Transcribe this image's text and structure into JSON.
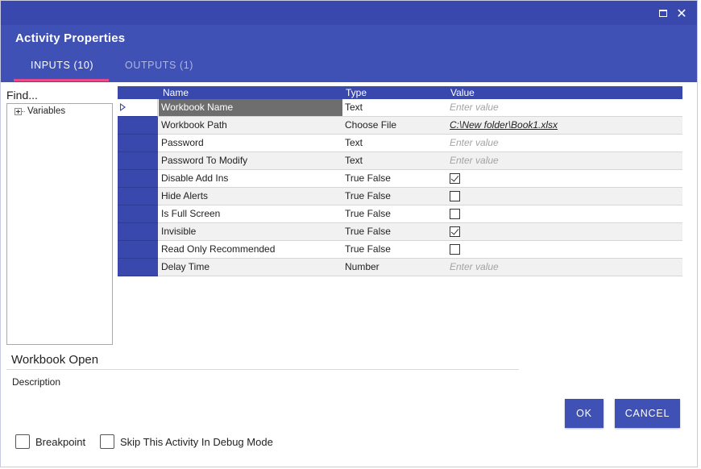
{
  "window": {
    "title": "Activity Properties",
    "maximize_icon": "maximize-icon",
    "close_icon": "close-icon",
    "close_glyph": "✕"
  },
  "tabs": [
    {
      "label": "INPUTS (10)",
      "active": true
    },
    {
      "label": "OUTPUTS (1)",
      "active": false
    }
  ],
  "sidebar": {
    "search_placeholder": "Find...",
    "tree": [
      {
        "label": "Variables",
        "expanded": false
      }
    ]
  },
  "grid": {
    "columns": [
      "Name",
      "Type",
      "Value"
    ],
    "rows": [
      {
        "name": "Workbook Name",
        "type": "Text",
        "value": "Enter value",
        "value_kind": "placeholder",
        "selected": true
      },
      {
        "name": "Workbook Path",
        "type": "Choose File",
        "value": "C:\\New folder\\Book1.xlsx",
        "value_kind": "link"
      },
      {
        "name": "Password",
        "type": "Text",
        "value": "Enter value",
        "value_kind": "placeholder"
      },
      {
        "name": "Password To Modify",
        "type": "Text",
        "value": "Enter value",
        "value_kind": "placeholder"
      },
      {
        "name": "Disable Add Ins",
        "type": "True False",
        "checked": true,
        "value_kind": "checkbox"
      },
      {
        "name": "Hide Alerts",
        "type": "True False",
        "checked": false,
        "value_kind": "checkbox"
      },
      {
        "name": "Is Full Screen",
        "type": "True False",
        "checked": false,
        "value_kind": "checkbox"
      },
      {
        "name": "Invisible",
        "type": "True False",
        "checked": true,
        "value_kind": "checkbox"
      },
      {
        "name": "Read Only Recommended",
        "type": "True False",
        "checked": false,
        "value_kind": "checkbox"
      },
      {
        "name": "Delay Time",
        "type": "Number",
        "value": "Enter value",
        "value_kind": "placeholder"
      }
    ]
  },
  "activity": {
    "name": "Workbook Open",
    "description_label": "Description"
  },
  "buttons": {
    "ok": "OK",
    "cancel": "CANCEL"
  },
  "options": {
    "breakpoint": {
      "label": "Breakpoint",
      "checked": false
    },
    "skip_debug": {
      "label": "Skip This Activity In Debug Mode",
      "checked": false
    }
  },
  "colors": {
    "titlebar": "#3948ad",
    "header": "#3f51b5",
    "tab_indicator": "#e84a8a",
    "button": "#3f51b5"
  }
}
